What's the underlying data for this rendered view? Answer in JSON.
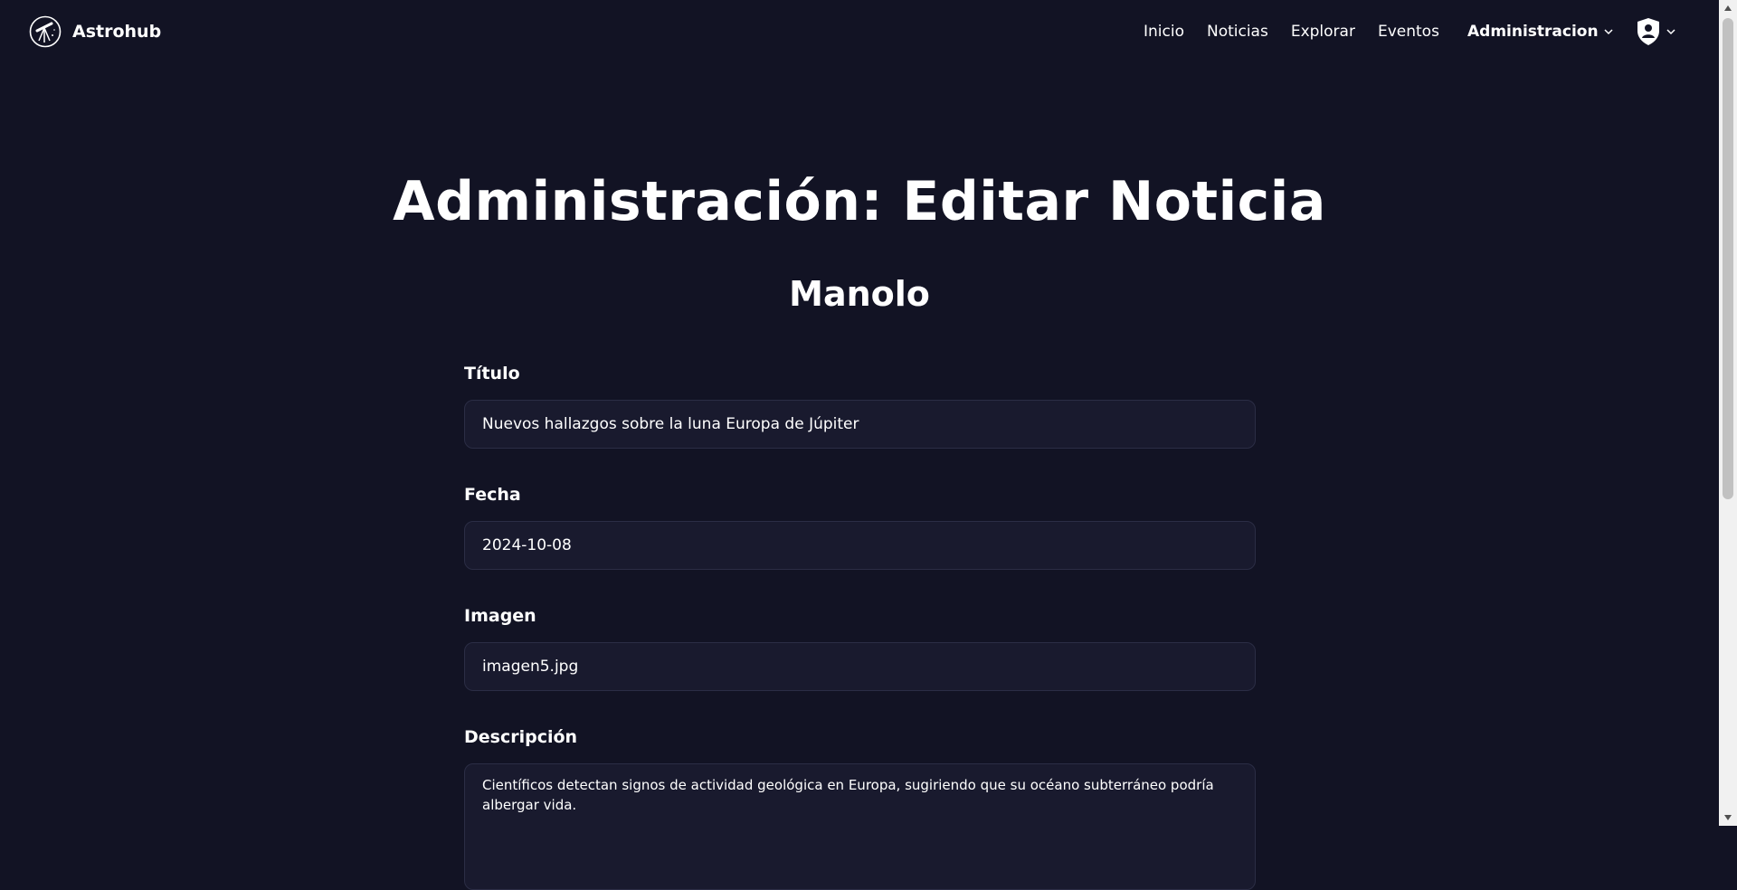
{
  "brand": {
    "name": "Astrohub",
    "logo_icon": "telescope-icon"
  },
  "nav": {
    "links": [
      "Inicio",
      "Noticias",
      "Explorar",
      "Eventos"
    ],
    "admin_label": "Administracion",
    "user_icon": "user-shield-icon"
  },
  "page": {
    "title": "Administración: Editar Noticia",
    "subtitle": "Manolo"
  },
  "form": {
    "titulo": {
      "label": "Título",
      "value": "Nuevos hallazgos sobre la luna Europa de Júpiter"
    },
    "fecha": {
      "label": "Fecha",
      "value": "2024-10-08"
    },
    "imagen": {
      "label": "Imagen",
      "value": "imagen5.jpg"
    },
    "descripcion": {
      "label": "Descripción",
      "value": "Científicos detectan signos de actividad geológica en Europa, sugiriendo que su océano subterráneo podría albergar vida."
    }
  },
  "colors": {
    "background": "#121324",
    "input_background": "#191a2e",
    "input_border": "#2b2d45",
    "text": "#ffffff"
  }
}
